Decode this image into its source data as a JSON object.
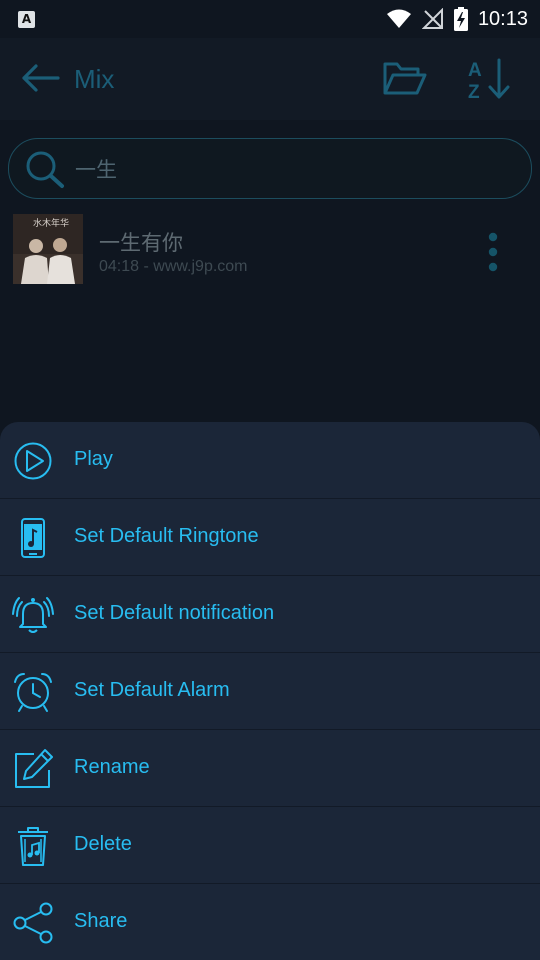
{
  "status_bar": {
    "notification_badge": "A",
    "time": "10:13"
  },
  "app_bar": {
    "title": "Mix",
    "icons": [
      "back-arrow-icon",
      "folder-open-icon",
      "sort-az-icon"
    ]
  },
  "search": {
    "value": "一生",
    "icon": "search-icon"
  },
  "song": {
    "title": "一生有你",
    "subtitle": "04:18 - www.j9p.com",
    "album_art_text": "水木年华"
  },
  "menu": {
    "items": [
      {
        "label": "Play",
        "icon": "play-icon"
      },
      {
        "label": "Set Default Ringtone",
        "icon": "phone-ringtone-icon"
      },
      {
        "label": "Set Default notification",
        "icon": "bell-notification-icon"
      },
      {
        "label": "Set Default Alarm",
        "icon": "alarm-clock-icon"
      },
      {
        "label": "Rename",
        "icon": "edit-icon"
      },
      {
        "label": "Delete",
        "icon": "trash-icon"
      },
      {
        "label": "Share",
        "icon": "share-icon"
      }
    ]
  },
  "colors": {
    "background": "#0f1620",
    "sheet": "#1b2638",
    "accent": "#28bdf1",
    "app_bar_accent": "#1b5e78"
  }
}
